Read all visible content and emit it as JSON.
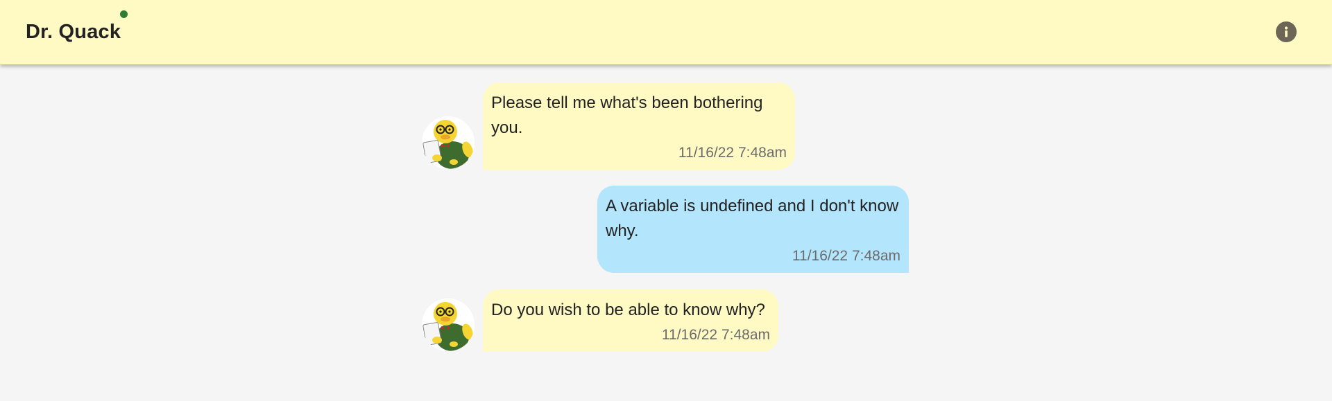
{
  "header": {
    "title": "Dr. Quack",
    "status": "online",
    "status_color": "#2e7d32",
    "background_color": "#fff9c4",
    "info_icon": "info-icon"
  },
  "colors": {
    "page_background": "#f5f5f5",
    "bot_bubble": "#fff9c4",
    "user_bubble": "#b3e5fc"
  },
  "messages": [
    {
      "sender": "bot",
      "avatar": "duck-doctor-avatar",
      "text": "Please tell me what's been bothering you.",
      "time": "11/16/22 7:48am"
    },
    {
      "sender": "user",
      "text": "A variable is undefined and I don't know why.",
      "time": "11/16/22 7:48am"
    },
    {
      "sender": "bot",
      "avatar": "duck-doctor-avatar",
      "text": "Do you wish to be able to know why?",
      "time": "11/16/22 7:48am"
    }
  ]
}
